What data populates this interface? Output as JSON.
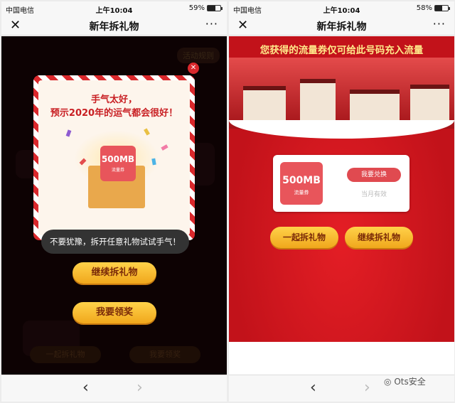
{
  "left": {
    "status": {
      "carrier": "中国电信",
      "time": "上午10:04",
      "battery": "59%",
      "battery_level": 0.59
    },
    "nav": {
      "close": "✕",
      "title": "新年拆礼物",
      "more": "···"
    },
    "rules_label": "活动规则",
    "popup": {
      "close": "✕",
      "line1": "手气太好，",
      "line2": "预示2020年的运气都会很好！",
      "coupon_amount": "500MB",
      "coupon_label": "流量券"
    },
    "toast": "不要犹豫，拆开任意礼物试试手气！",
    "btn_continue": "继续拆礼物",
    "btn_claim": "我要领奖",
    "ghost_together": "一起拆礼物",
    "ghost_claim": "我要领奖",
    "bottom": {
      "back": "‹",
      "forward": "›"
    }
  },
  "right": {
    "status": {
      "carrier": "中国电信",
      "time": "上午10:04",
      "battery": "58%",
      "battery_level": 0.58
    },
    "nav": {
      "close": "✕",
      "title": "新年拆礼物",
      "more": "···"
    },
    "banner": "您获得的流量券仅可给此号码充入流量",
    "coupon_amount": "500MB",
    "coupon_label": "流量券",
    "redeem": "我要兑换",
    "valid": "当月有效",
    "btn_together": "一起拆礼物",
    "btn_continue": "继续拆礼物",
    "bottom": {
      "back": "‹",
      "forward": "›"
    }
  },
  "watermark": "Ots安全",
  "colors": {
    "red": "#d9282c",
    "gold": "#ffd24a",
    "dark_bg": "#1b0507"
  }
}
